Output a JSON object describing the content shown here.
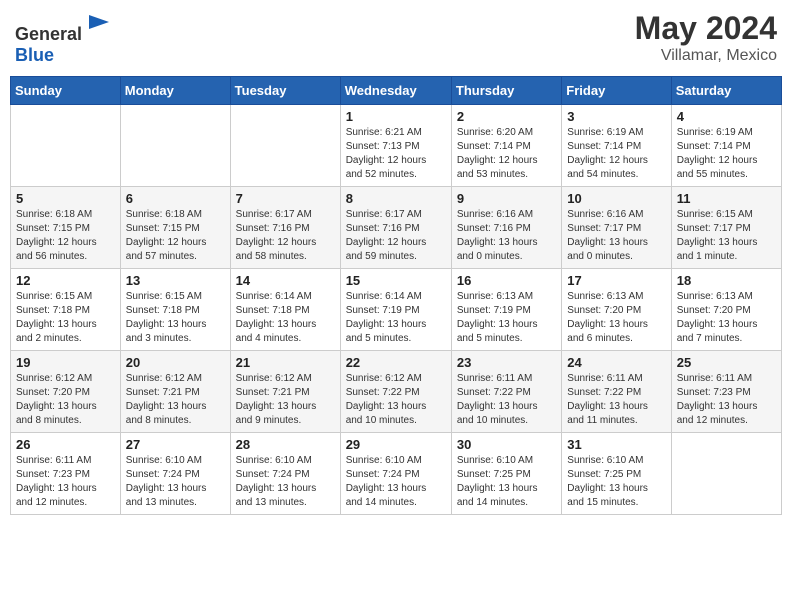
{
  "header": {
    "logo_line1": "General",
    "logo_line2": "Blue",
    "month": "May 2024",
    "location": "Villamar, Mexico"
  },
  "weekdays": [
    "Sunday",
    "Monday",
    "Tuesday",
    "Wednesday",
    "Thursday",
    "Friday",
    "Saturday"
  ],
  "weeks": [
    [
      {
        "day": "",
        "info": ""
      },
      {
        "day": "",
        "info": ""
      },
      {
        "day": "",
        "info": ""
      },
      {
        "day": "1",
        "info": "Sunrise: 6:21 AM\nSunset: 7:13 PM\nDaylight: 12 hours\nand 52 minutes."
      },
      {
        "day": "2",
        "info": "Sunrise: 6:20 AM\nSunset: 7:14 PM\nDaylight: 12 hours\nand 53 minutes."
      },
      {
        "day": "3",
        "info": "Sunrise: 6:19 AM\nSunset: 7:14 PM\nDaylight: 12 hours\nand 54 minutes."
      },
      {
        "day": "4",
        "info": "Sunrise: 6:19 AM\nSunset: 7:14 PM\nDaylight: 12 hours\nand 55 minutes."
      }
    ],
    [
      {
        "day": "5",
        "info": "Sunrise: 6:18 AM\nSunset: 7:15 PM\nDaylight: 12 hours\nand 56 minutes."
      },
      {
        "day": "6",
        "info": "Sunrise: 6:18 AM\nSunset: 7:15 PM\nDaylight: 12 hours\nand 57 minutes."
      },
      {
        "day": "7",
        "info": "Sunrise: 6:17 AM\nSunset: 7:16 PM\nDaylight: 12 hours\nand 58 minutes."
      },
      {
        "day": "8",
        "info": "Sunrise: 6:17 AM\nSunset: 7:16 PM\nDaylight: 12 hours\nand 59 minutes."
      },
      {
        "day": "9",
        "info": "Sunrise: 6:16 AM\nSunset: 7:16 PM\nDaylight: 13 hours\nand 0 minutes."
      },
      {
        "day": "10",
        "info": "Sunrise: 6:16 AM\nSunset: 7:17 PM\nDaylight: 13 hours\nand 0 minutes."
      },
      {
        "day": "11",
        "info": "Sunrise: 6:15 AM\nSunset: 7:17 PM\nDaylight: 13 hours\nand 1 minute."
      }
    ],
    [
      {
        "day": "12",
        "info": "Sunrise: 6:15 AM\nSunset: 7:18 PM\nDaylight: 13 hours\nand 2 minutes."
      },
      {
        "day": "13",
        "info": "Sunrise: 6:15 AM\nSunset: 7:18 PM\nDaylight: 13 hours\nand 3 minutes."
      },
      {
        "day": "14",
        "info": "Sunrise: 6:14 AM\nSunset: 7:18 PM\nDaylight: 13 hours\nand 4 minutes."
      },
      {
        "day": "15",
        "info": "Sunrise: 6:14 AM\nSunset: 7:19 PM\nDaylight: 13 hours\nand 5 minutes."
      },
      {
        "day": "16",
        "info": "Sunrise: 6:13 AM\nSunset: 7:19 PM\nDaylight: 13 hours\nand 5 minutes."
      },
      {
        "day": "17",
        "info": "Sunrise: 6:13 AM\nSunset: 7:20 PM\nDaylight: 13 hours\nand 6 minutes."
      },
      {
        "day": "18",
        "info": "Sunrise: 6:13 AM\nSunset: 7:20 PM\nDaylight: 13 hours\nand 7 minutes."
      }
    ],
    [
      {
        "day": "19",
        "info": "Sunrise: 6:12 AM\nSunset: 7:20 PM\nDaylight: 13 hours\nand 8 minutes."
      },
      {
        "day": "20",
        "info": "Sunrise: 6:12 AM\nSunset: 7:21 PM\nDaylight: 13 hours\nand 8 minutes."
      },
      {
        "day": "21",
        "info": "Sunrise: 6:12 AM\nSunset: 7:21 PM\nDaylight: 13 hours\nand 9 minutes."
      },
      {
        "day": "22",
        "info": "Sunrise: 6:12 AM\nSunset: 7:22 PM\nDaylight: 13 hours\nand 10 minutes."
      },
      {
        "day": "23",
        "info": "Sunrise: 6:11 AM\nSunset: 7:22 PM\nDaylight: 13 hours\nand 10 minutes."
      },
      {
        "day": "24",
        "info": "Sunrise: 6:11 AM\nSunset: 7:22 PM\nDaylight: 13 hours\nand 11 minutes."
      },
      {
        "day": "25",
        "info": "Sunrise: 6:11 AM\nSunset: 7:23 PM\nDaylight: 13 hours\nand 12 minutes."
      }
    ],
    [
      {
        "day": "26",
        "info": "Sunrise: 6:11 AM\nSunset: 7:23 PM\nDaylight: 13 hours\nand 12 minutes."
      },
      {
        "day": "27",
        "info": "Sunrise: 6:10 AM\nSunset: 7:24 PM\nDaylight: 13 hours\nand 13 minutes."
      },
      {
        "day": "28",
        "info": "Sunrise: 6:10 AM\nSunset: 7:24 PM\nDaylight: 13 hours\nand 13 minutes."
      },
      {
        "day": "29",
        "info": "Sunrise: 6:10 AM\nSunset: 7:24 PM\nDaylight: 13 hours\nand 14 minutes."
      },
      {
        "day": "30",
        "info": "Sunrise: 6:10 AM\nSunset: 7:25 PM\nDaylight: 13 hours\nand 14 minutes."
      },
      {
        "day": "31",
        "info": "Sunrise: 6:10 AM\nSunset: 7:25 PM\nDaylight: 13 hours\nand 15 minutes."
      },
      {
        "day": "",
        "info": ""
      }
    ]
  ]
}
